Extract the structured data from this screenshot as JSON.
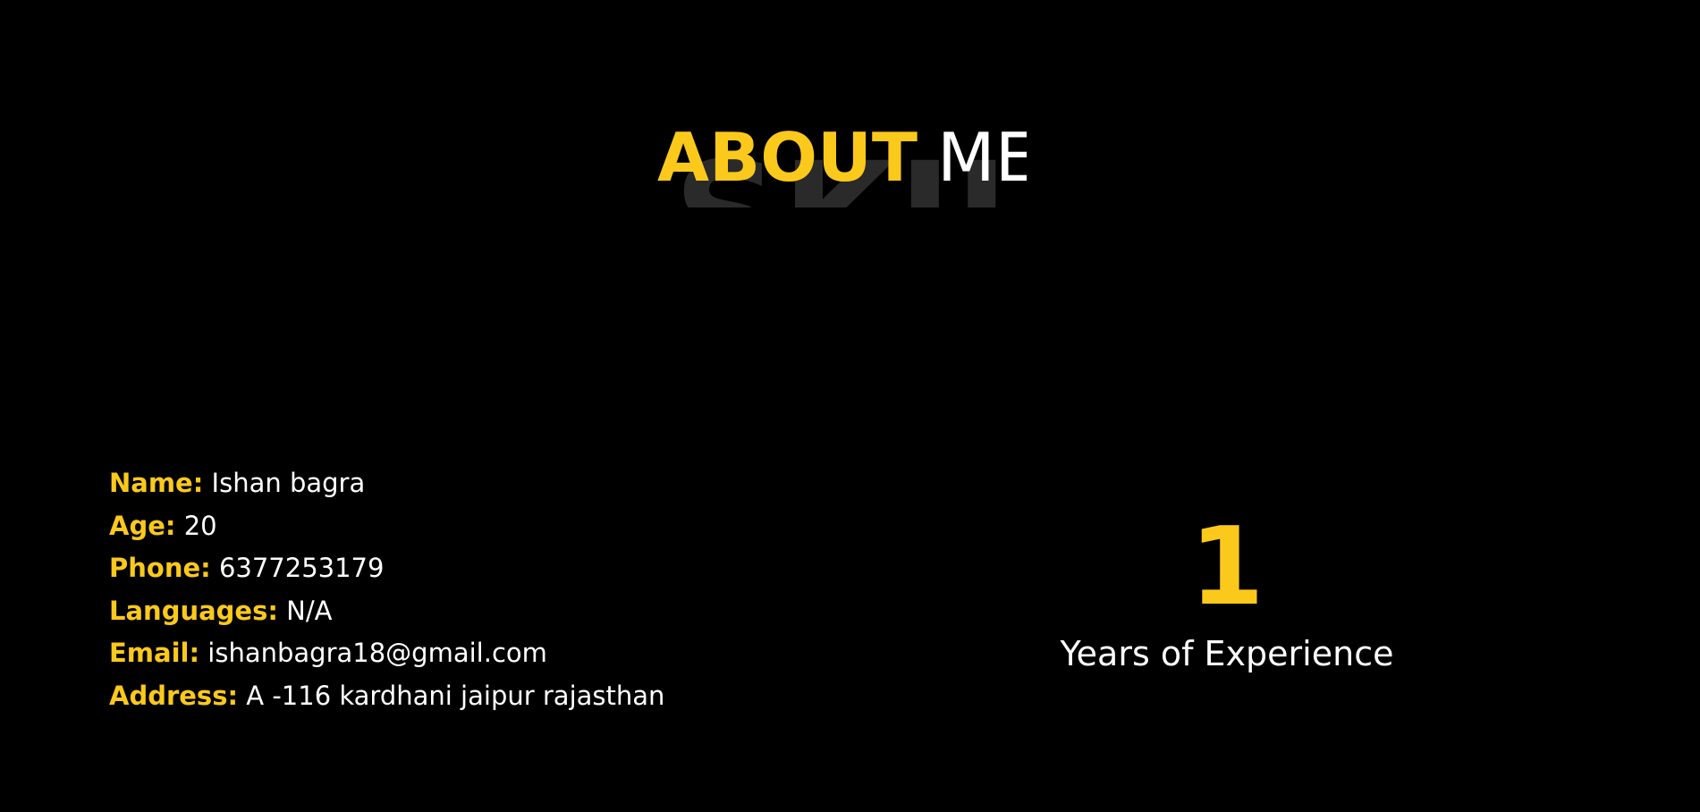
{
  "colors": {
    "background": "#000000",
    "accent": "#fbc91b",
    "text": "#ffffff",
    "ghost_text": "#2a2a2a"
  },
  "section": {
    "title_accent": "ABOUT",
    "title_plain": "ME"
  },
  "info": [
    {
      "label": "Name:",
      "value": "Ishan bagra"
    },
    {
      "label": "Age:",
      "value": "20"
    },
    {
      "label": "Phone:",
      "value": "6377253179"
    },
    {
      "label": "Languages:",
      "value": "N/A"
    },
    {
      "label": "Email:",
      "value": "ishanbagra18@gmail.com"
    },
    {
      "label": "Address:",
      "value": "A -116 kardhani jaipur rajasthan"
    }
  ],
  "stat": {
    "number": "1",
    "label": "Years of Experience"
  }
}
